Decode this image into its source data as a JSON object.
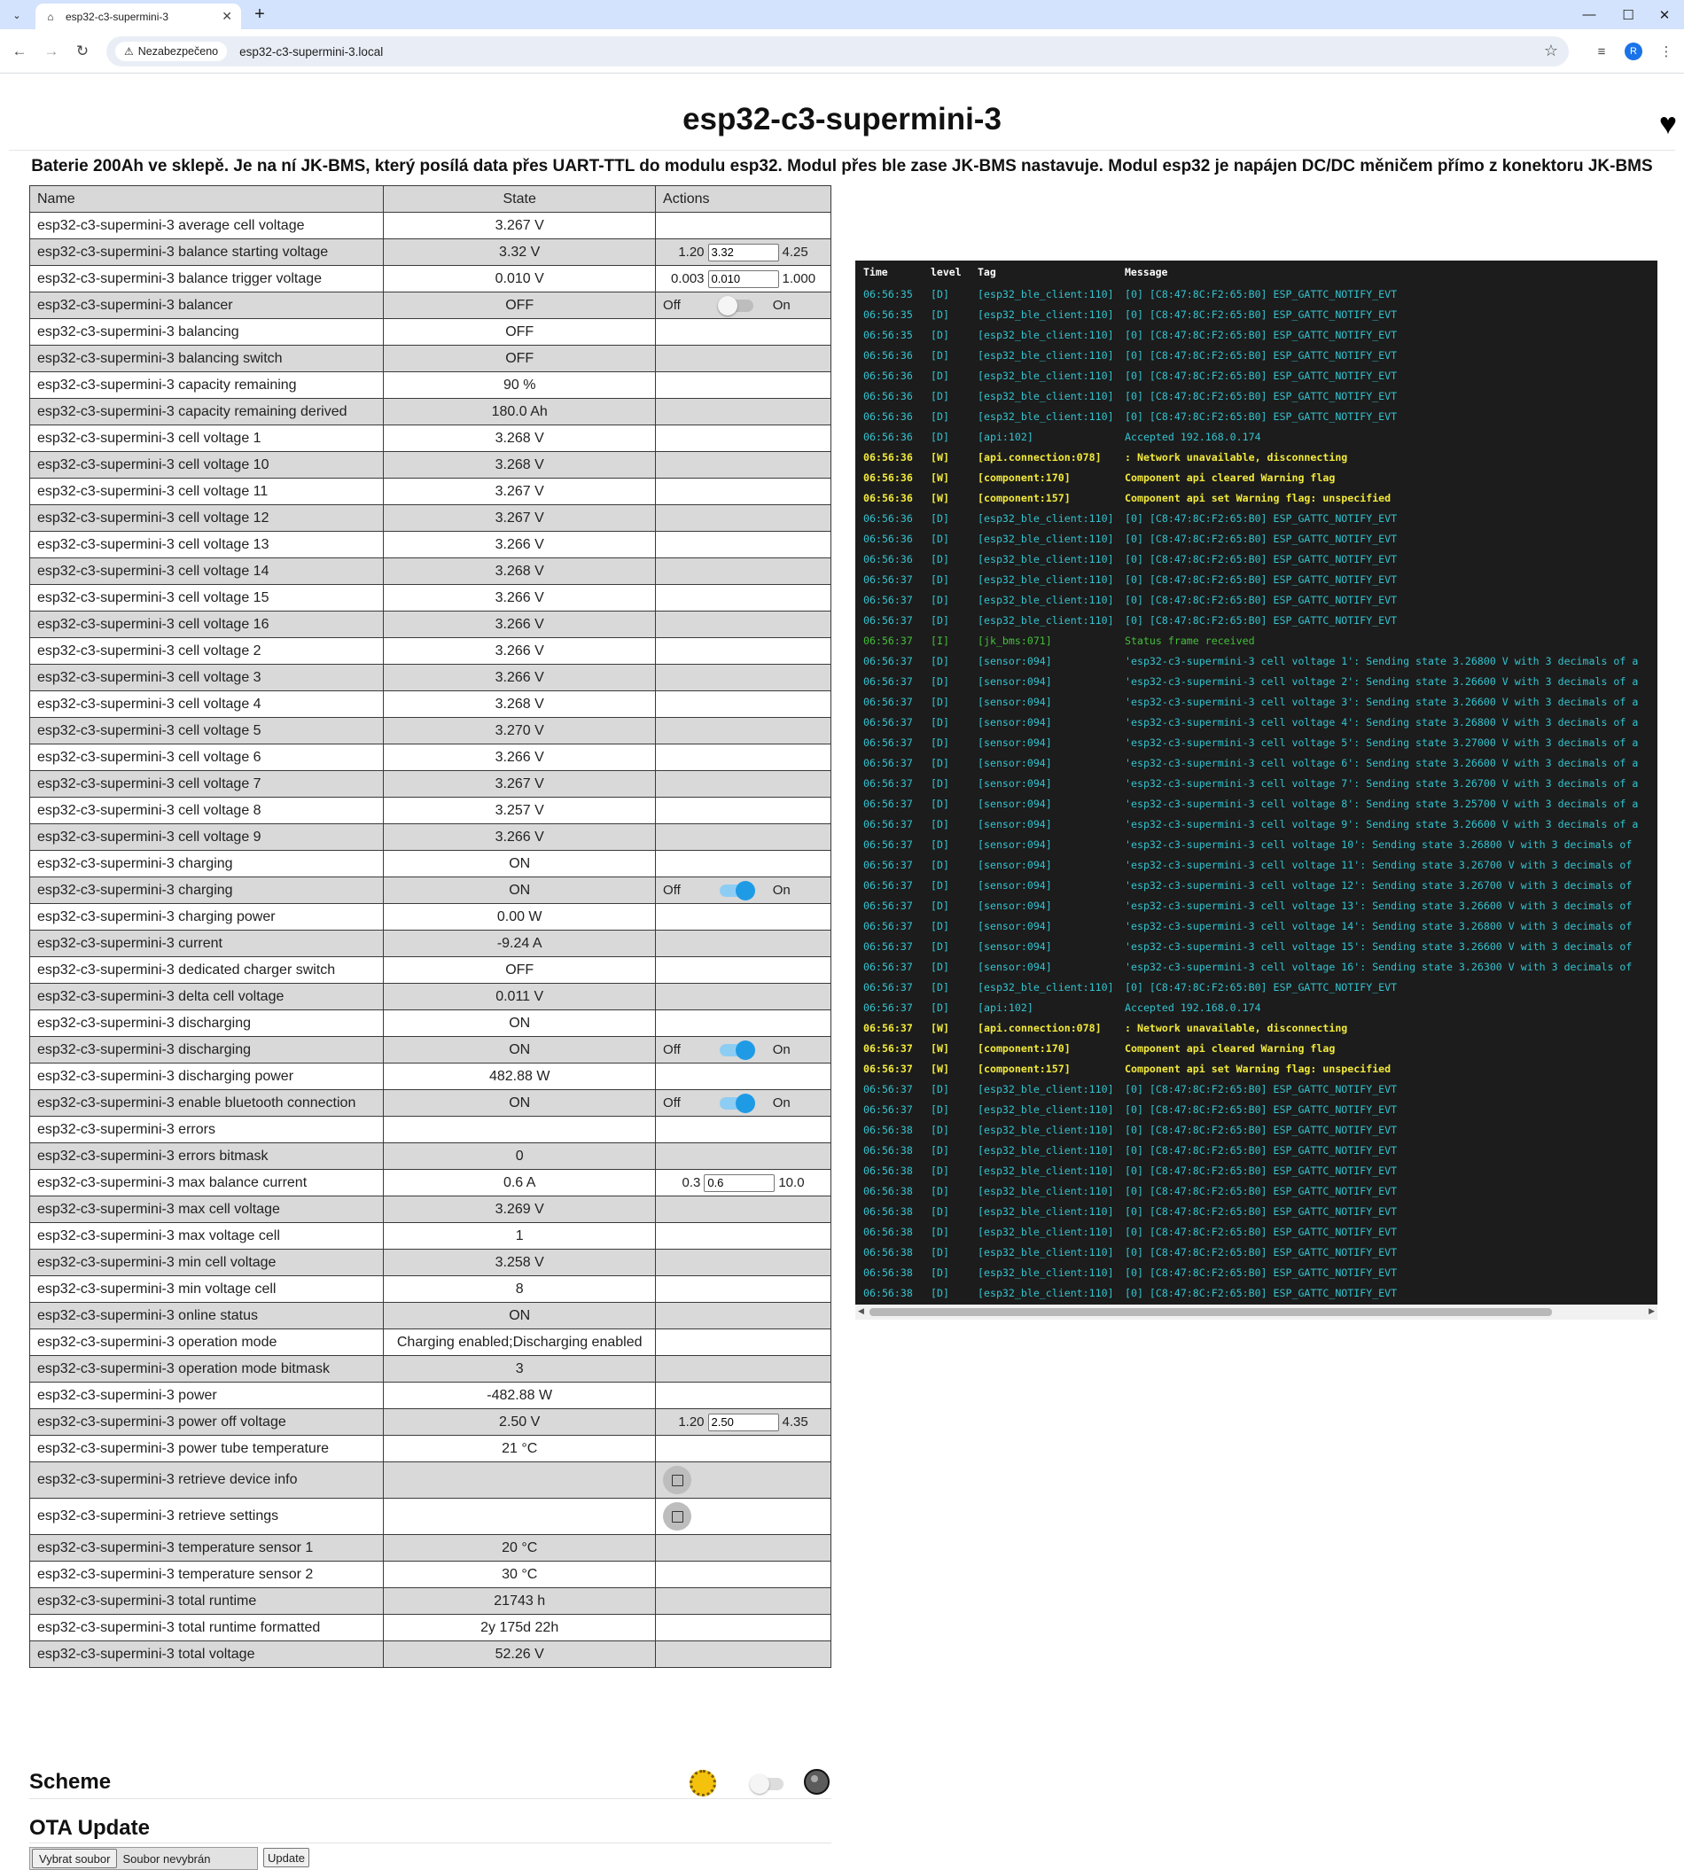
{
  "browser": {
    "tab_title": "esp32-c3-supermini-3",
    "security_label": "Nezabezpečeno",
    "url": "esp32-c3-supermini-3.local",
    "profile_initial": "R"
  },
  "page": {
    "title": "esp32-c3-supermini-3",
    "description": "Baterie 200Ah ve sklepě. Je na ní JK-BMS, který posílá data přes UART-TTL do modulu esp32. Modul přes ble zase JK-BMS nastavuje. Modul esp32 je napájen DC/DC měničem přímo z konektoru JK-BMS"
  },
  "table": {
    "headers": {
      "name": "Name",
      "state": "State",
      "actions": "Actions"
    },
    "rows": [
      {
        "name": "esp32-c3-supermini-3 average cell voltage",
        "state": "3.267 V"
      },
      {
        "name": "esp32-c3-supermini-3 balance starting voltage",
        "state": "3.32 V",
        "action": {
          "type": "number",
          "min": "1.20",
          "value": "3.32",
          "max": "4.25"
        }
      },
      {
        "name": "esp32-c3-supermini-3 balance trigger voltage",
        "state": "0.010 V",
        "action": {
          "type": "number",
          "min": "0.003",
          "value": "0.010",
          "max": "1.000"
        }
      },
      {
        "name": "esp32-c3-supermini-3 balancer",
        "state": "OFF",
        "action": {
          "type": "switch",
          "on": false,
          "off_label": "Off",
          "on_label": "On"
        }
      },
      {
        "name": "esp32-c3-supermini-3 balancing",
        "state": "OFF"
      },
      {
        "name": "esp32-c3-supermini-3 balancing switch",
        "state": "OFF"
      },
      {
        "name": "esp32-c3-supermini-3 capacity remaining",
        "state": "90 %"
      },
      {
        "name": "esp32-c3-supermini-3 capacity remaining derived",
        "state": "180.0 Ah"
      },
      {
        "name": "esp32-c3-supermini-3 cell voltage 1",
        "state": "3.268 V"
      },
      {
        "name": "esp32-c3-supermini-3 cell voltage 10",
        "state": "3.268 V"
      },
      {
        "name": "esp32-c3-supermini-3 cell voltage 11",
        "state": "3.267 V"
      },
      {
        "name": "esp32-c3-supermini-3 cell voltage 12",
        "state": "3.267 V"
      },
      {
        "name": "esp32-c3-supermini-3 cell voltage 13",
        "state": "3.266 V"
      },
      {
        "name": "esp32-c3-supermini-3 cell voltage 14",
        "state": "3.268 V"
      },
      {
        "name": "esp32-c3-supermini-3 cell voltage 15",
        "state": "3.266 V"
      },
      {
        "name": "esp32-c3-supermini-3 cell voltage 16",
        "state": "3.266 V"
      },
      {
        "name": "esp32-c3-supermini-3 cell voltage 2",
        "state": "3.266 V"
      },
      {
        "name": "esp32-c3-supermini-3 cell voltage 3",
        "state": "3.266 V"
      },
      {
        "name": "esp32-c3-supermini-3 cell voltage 4",
        "state": "3.268 V"
      },
      {
        "name": "esp32-c3-supermini-3 cell voltage 5",
        "state": "3.270 V"
      },
      {
        "name": "esp32-c3-supermini-3 cell voltage 6",
        "state": "3.266 V"
      },
      {
        "name": "esp32-c3-supermini-3 cell voltage 7",
        "state": "3.267 V"
      },
      {
        "name": "esp32-c3-supermini-3 cell voltage 8",
        "state": "3.257 V"
      },
      {
        "name": "esp32-c3-supermini-3 cell voltage 9",
        "state": "3.266 V"
      },
      {
        "name": "esp32-c3-supermini-3 charging",
        "state": "ON"
      },
      {
        "name": "esp32-c3-supermini-3 charging",
        "state": "ON",
        "action": {
          "type": "switch",
          "on": true,
          "off_label": "Off",
          "on_label": "On"
        }
      },
      {
        "name": "esp32-c3-supermini-3 charging power",
        "state": "0.00 W"
      },
      {
        "name": "esp32-c3-supermini-3 current",
        "state": "-9.24 A"
      },
      {
        "name": "esp32-c3-supermini-3 dedicated charger switch",
        "state": "OFF"
      },
      {
        "name": "esp32-c3-supermini-3 delta cell voltage",
        "state": "0.011 V"
      },
      {
        "name": "esp32-c3-supermini-3 discharging",
        "state": "ON"
      },
      {
        "name": "esp32-c3-supermini-3 discharging",
        "state": "ON",
        "action": {
          "type": "switch",
          "on": true,
          "off_label": "Off",
          "on_label": "On"
        }
      },
      {
        "name": "esp32-c3-supermini-3 discharging power",
        "state": "482.88 W"
      },
      {
        "name": "esp32-c3-supermini-3 enable bluetooth connection",
        "state": "ON",
        "action": {
          "type": "switch",
          "on": true,
          "off_label": "Off",
          "on_label": "On"
        }
      },
      {
        "name": "esp32-c3-supermini-3 errors",
        "state": ""
      },
      {
        "name": "esp32-c3-supermini-3 errors bitmask",
        "state": "0"
      },
      {
        "name": "esp32-c3-supermini-3 max balance current",
        "state": "0.6 A",
        "action": {
          "type": "number",
          "min": "0.3",
          "value": "0.6",
          "max": "10.0"
        }
      },
      {
        "name": "esp32-c3-supermini-3 max cell voltage",
        "state": "3.269 V"
      },
      {
        "name": "esp32-c3-supermini-3 max voltage cell",
        "state": "1"
      },
      {
        "name": "esp32-c3-supermini-3 min cell voltage",
        "state": "3.258 V"
      },
      {
        "name": "esp32-c3-supermini-3 min voltage cell",
        "state": "8"
      },
      {
        "name": "esp32-c3-supermini-3 online status",
        "state": "ON"
      },
      {
        "name": "esp32-c3-supermini-3 operation mode",
        "state": "Charging enabled;Discharging enabled"
      },
      {
        "name": "esp32-c3-supermini-3 operation mode bitmask",
        "state": "3"
      },
      {
        "name": "esp32-c3-supermini-3 power",
        "state": "-482.88 W"
      },
      {
        "name": "esp32-c3-supermini-3 power off voltage",
        "state": "2.50 V",
        "action": {
          "type": "number",
          "min": "1.20",
          "value": "2.50",
          "max": "4.35"
        }
      },
      {
        "name": "esp32-c3-supermini-3 power tube temperature",
        "state": "21 °C"
      },
      {
        "name": "esp32-c3-supermini-3 retrieve device info",
        "state": "",
        "action": {
          "type": "button"
        }
      },
      {
        "name": "esp32-c3-supermini-3 retrieve settings",
        "state": "",
        "action": {
          "type": "button"
        }
      },
      {
        "name": "esp32-c3-supermini-3 temperature sensor 1",
        "state": "20 °C"
      },
      {
        "name": "esp32-c3-supermini-3 temperature sensor 2",
        "state": "30 °C"
      },
      {
        "name": "esp32-c3-supermini-3 total runtime",
        "state": "21743 h"
      },
      {
        "name": "esp32-c3-supermini-3 total runtime formatted",
        "state": "2y 175d 22h"
      },
      {
        "name": "esp32-c3-supermini-3 total voltage",
        "state": "52.26 V"
      }
    ]
  },
  "log": {
    "headers": {
      "time": "Time",
      "level": "level",
      "tag": "Tag",
      "message": "Message"
    },
    "rows": [
      {
        "time": "06:56:35",
        "level": "D",
        "tag": "[esp32_ble_client:110]",
        "msg": "[0] [C8:47:8C:F2:65:B0] ESP_GATTC_NOTIFY_EVT"
      },
      {
        "time": "06:56:35",
        "level": "D",
        "tag": "[esp32_ble_client:110]",
        "msg": "[0] [C8:47:8C:F2:65:B0] ESP_GATTC_NOTIFY_EVT"
      },
      {
        "time": "06:56:35",
        "level": "D",
        "tag": "[esp32_ble_client:110]",
        "msg": "[0] [C8:47:8C:F2:65:B0] ESP_GATTC_NOTIFY_EVT"
      },
      {
        "time": "06:56:36",
        "level": "D",
        "tag": "[esp32_ble_client:110]",
        "msg": "[0] [C8:47:8C:F2:65:B0] ESP_GATTC_NOTIFY_EVT"
      },
      {
        "time": "06:56:36",
        "level": "D",
        "tag": "[esp32_ble_client:110]",
        "msg": "[0] [C8:47:8C:F2:65:B0] ESP_GATTC_NOTIFY_EVT"
      },
      {
        "time": "06:56:36",
        "level": "D",
        "tag": "[esp32_ble_client:110]",
        "msg": "[0] [C8:47:8C:F2:65:B0] ESP_GATTC_NOTIFY_EVT"
      },
      {
        "time": "06:56:36",
        "level": "D",
        "tag": "[esp32_ble_client:110]",
        "msg": "[0] [C8:47:8C:F2:65:B0] ESP_GATTC_NOTIFY_EVT"
      },
      {
        "time": "06:56:36",
        "level": "D",
        "tag": "[api:102]",
        "msg": "Accepted 192.168.0.174"
      },
      {
        "time": "06:56:36",
        "level": "W",
        "tag": "[api.connection:078]",
        "msg": ": Network unavailable, disconnecting"
      },
      {
        "time": "06:56:36",
        "level": "W",
        "tag": "[component:170]",
        "msg": "Component api cleared Warning flag"
      },
      {
        "time": "06:56:36",
        "level": "W",
        "tag": "[component:157]",
        "msg": "Component api set Warning flag: unspecified"
      },
      {
        "time": "06:56:36",
        "level": "D",
        "tag": "[esp32_ble_client:110]",
        "msg": "[0] [C8:47:8C:F2:65:B0] ESP_GATTC_NOTIFY_EVT"
      },
      {
        "time": "06:56:36",
        "level": "D",
        "tag": "[esp32_ble_client:110]",
        "msg": "[0] [C8:47:8C:F2:65:B0] ESP_GATTC_NOTIFY_EVT"
      },
      {
        "time": "06:56:36",
        "level": "D",
        "tag": "[esp32_ble_client:110]",
        "msg": "[0] [C8:47:8C:F2:65:B0] ESP_GATTC_NOTIFY_EVT"
      },
      {
        "time": "06:56:37",
        "level": "D",
        "tag": "[esp32_ble_client:110]",
        "msg": "[0] [C8:47:8C:F2:65:B0] ESP_GATTC_NOTIFY_EVT"
      },
      {
        "time": "06:56:37",
        "level": "D",
        "tag": "[esp32_ble_client:110]",
        "msg": "[0] [C8:47:8C:F2:65:B0] ESP_GATTC_NOTIFY_EVT"
      },
      {
        "time": "06:56:37",
        "level": "D",
        "tag": "[esp32_ble_client:110]",
        "msg": "[0] [C8:47:8C:F2:65:B0] ESP_GATTC_NOTIFY_EVT"
      },
      {
        "time": "06:56:37",
        "level": "I",
        "tag": "[jk_bms:071]",
        "msg": "Status frame received"
      },
      {
        "time": "06:56:37",
        "level": "D",
        "tag": "[sensor:094]",
        "msg": "'esp32-c3-supermini-3 cell voltage 1': Sending state 3.26800 V with 3 decimals of a"
      },
      {
        "time": "06:56:37",
        "level": "D",
        "tag": "[sensor:094]",
        "msg": "'esp32-c3-supermini-3 cell voltage 2': Sending state 3.26600 V with 3 decimals of a"
      },
      {
        "time": "06:56:37",
        "level": "D",
        "tag": "[sensor:094]",
        "msg": "'esp32-c3-supermini-3 cell voltage 3': Sending state 3.26600 V with 3 decimals of a"
      },
      {
        "time": "06:56:37",
        "level": "D",
        "tag": "[sensor:094]",
        "msg": "'esp32-c3-supermini-3 cell voltage 4': Sending state 3.26800 V with 3 decimals of a"
      },
      {
        "time": "06:56:37",
        "level": "D",
        "tag": "[sensor:094]",
        "msg": "'esp32-c3-supermini-3 cell voltage 5': Sending state 3.27000 V with 3 decimals of a"
      },
      {
        "time": "06:56:37",
        "level": "D",
        "tag": "[sensor:094]",
        "msg": "'esp32-c3-supermini-3 cell voltage 6': Sending state 3.26600 V with 3 decimals of a"
      },
      {
        "time": "06:56:37",
        "level": "D",
        "tag": "[sensor:094]",
        "msg": "'esp32-c3-supermini-3 cell voltage 7': Sending state 3.26700 V with 3 decimals of a"
      },
      {
        "time": "06:56:37",
        "level": "D",
        "tag": "[sensor:094]",
        "msg": "'esp32-c3-supermini-3 cell voltage 8': Sending state 3.25700 V with 3 decimals of a"
      },
      {
        "time": "06:56:37",
        "level": "D",
        "tag": "[sensor:094]",
        "msg": "'esp32-c3-supermini-3 cell voltage 9': Sending state 3.26600 V with 3 decimals of a"
      },
      {
        "time": "06:56:37",
        "level": "D",
        "tag": "[sensor:094]",
        "msg": "'esp32-c3-supermini-3 cell voltage 10': Sending state 3.26800 V with 3 decimals of"
      },
      {
        "time": "06:56:37",
        "level": "D",
        "tag": "[sensor:094]",
        "msg": "'esp32-c3-supermini-3 cell voltage 11': Sending state 3.26700 V with 3 decimals of"
      },
      {
        "time": "06:56:37",
        "level": "D",
        "tag": "[sensor:094]",
        "msg": "'esp32-c3-supermini-3 cell voltage 12': Sending state 3.26700 V with 3 decimals of"
      },
      {
        "time": "06:56:37",
        "level": "D",
        "tag": "[sensor:094]",
        "msg": "'esp32-c3-supermini-3 cell voltage 13': Sending state 3.26600 V with 3 decimals of"
      },
      {
        "time": "06:56:37",
        "level": "D",
        "tag": "[sensor:094]",
        "msg": "'esp32-c3-supermini-3 cell voltage 14': Sending state 3.26800 V with 3 decimals of"
      },
      {
        "time": "06:56:37",
        "level": "D",
        "tag": "[sensor:094]",
        "msg": "'esp32-c3-supermini-3 cell voltage 15': Sending state 3.26600 V with 3 decimals of"
      },
      {
        "time": "06:56:37",
        "level": "D",
        "tag": "[sensor:094]",
        "msg": "'esp32-c3-supermini-3 cell voltage 16': Sending state 3.26300 V with 3 decimals of"
      },
      {
        "time": "06:56:37",
        "level": "D",
        "tag": "[esp32_ble_client:110]",
        "msg": "[0] [C8:47:8C:F2:65:B0] ESP_GATTC_NOTIFY_EVT"
      },
      {
        "time": "06:56:37",
        "level": "D",
        "tag": "[api:102]",
        "msg": "Accepted 192.168.0.174"
      },
      {
        "time": "06:56:37",
        "level": "W",
        "tag": "[api.connection:078]",
        "msg": ": Network unavailable, disconnecting"
      },
      {
        "time": "06:56:37",
        "level": "W",
        "tag": "[component:170]",
        "msg": "Component api cleared Warning flag"
      },
      {
        "time": "06:56:37",
        "level": "W",
        "tag": "[component:157]",
        "msg": "Component api set Warning flag: unspecified"
      },
      {
        "time": "06:56:37",
        "level": "D",
        "tag": "[esp32_ble_client:110]",
        "msg": "[0] [C8:47:8C:F2:65:B0] ESP_GATTC_NOTIFY_EVT"
      },
      {
        "time": "06:56:37",
        "level": "D",
        "tag": "[esp32_ble_client:110]",
        "msg": "[0] [C8:47:8C:F2:65:B0] ESP_GATTC_NOTIFY_EVT"
      },
      {
        "time": "06:56:38",
        "level": "D",
        "tag": "[esp32_ble_client:110]",
        "msg": "[0] [C8:47:8C:F2:65:B0] ESP_GATTC_NOTIFY_EVT"
      },
      {
        "time": "06:56:38",
        "level": "D",
        "tag": "[esp32_ble_client:110]",
        "msg": "[0] [C8:47:8C:F2:65:B0] ESP_GATTC_NOTIFY_EVT"
      },
      {
        "time": "06:56:38",
        "level": "D",
        "tag": "[esp32_ble_client:110]",
        "msg": "[0] [C8:47:8C:F2:65:B0] ESP_GATTC_NOTIFY_EVT"
      },
      {
        "time": "06:56:38",
        "level": "D",
        "tag": "[esp32_ble_client:110]",
        "msg": "[0] [C8:47:8C:F2:65:B0] ESP_GATTC_NOTIFY_EVT"
      },
      {
        "time": "06:56:38",
        "level": "D",
        "tag": "[esp32_ble_client:110]",
        "msg": "[0] [C8:47:8C:F2:65:B0] ESP_GATTC_NOTIFY_EVT"
      },
      {
        "time": "06:56:38",
        "level": "D",
        "tag": "[esp32_ble_client:110]",
        "msg": "[0] [C8:47:8C:F2:65:B0] ESP_GATTC_NOTIFY_EVT"
      },
      {
        "time": "06:56:38",
        "level": "D",
        "tag": "[esp32_ble_client:110]",
        "msg": "[0] [C8:47:8C:F2:65:B0] ESP_GATTC_NOTIFY_EVT"
      },
      {
        "time": "06:56:38",
        "level": "D",
        "tag": "[esp32_ble_client:110]",
        "msg": "[0] [C8:47:8C:F2:65:B0] ESP_GATTC_NOTIFY_EVT"
      },
      {
        "time": "06:56:38",
        "level": "D",
        "tag": "[esp32_ble_client:110]",
        "msg": "[0] [C8:47:8C:F2:65:B0] ESP_GATTC_NOTIFY_EVT"
      }
    ]
  },
  "scheme": {
    "title": "Scheme",
    "dark_enabled": false
  },
  "ota": {
    "title": "OTA Update",
    "choose_label": "Vybrat soubor",
    "no_file_label": "Soubor nevybrán",
    "update_label": "Update"
  },
  "colors": {
    "log_debug": "#34c3cf",
    "log_warning": "#f2ea3c",
    "log_info": "#44bf3a",
    "switch_on": "#1f9be6"
  }
}
